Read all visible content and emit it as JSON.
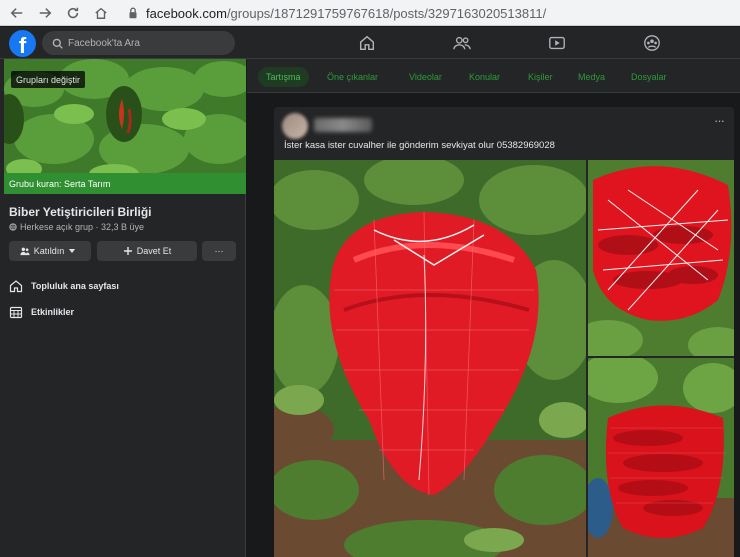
{
  "browser": {
    "url_domain": "facebook.com",
    "url_path": "/groups/1871291759767618/posts/3297163020513811/"
  },
  "topbar": {
    "logo": "f",
    "search_placeholder": "Facebook'ta Ara"
  },
  "group": {
    "change_label": "Grupları değiştir",
    "founder_label": "Grubu kuran: Serta Tarım",
    "name": "Biber Yetiştiricileri Birliği",
    "meta": "Herkese açık grup · 32,3 B üye",
    "join_label": "Katıldın",
    "invite_label": "Davet Et",
    "more_label": "···",
    "menu": [
      {
        "label": "Topluluk ana sayfası"
      },
      {
        "label": "Etkinlikler"
      }
    ]
  },
  "tabs": [
    {
      "label": "Tartışma"
    },
    {
      "label": "Öne çıkanlar"
    },
    {
      "label": "Videolar"
    },
    {
      "label": "Konular"
    },
    {
      "label": "Kişiler"
    },
    {
      "label": "Medya"
    },
    {
      "label": "Dosyalar"
    }
  ],
  "post": {
    "text": "İster kasa ister cuvalher ile gönderim sevkiyat olur 05382969028",
    "more": "···"
  },
  "colors": {
    "fb_blue": "#1877f2",
    "group_green": "#2f8f31",
    "tab_green": "#2d9b3a"
  }
}
